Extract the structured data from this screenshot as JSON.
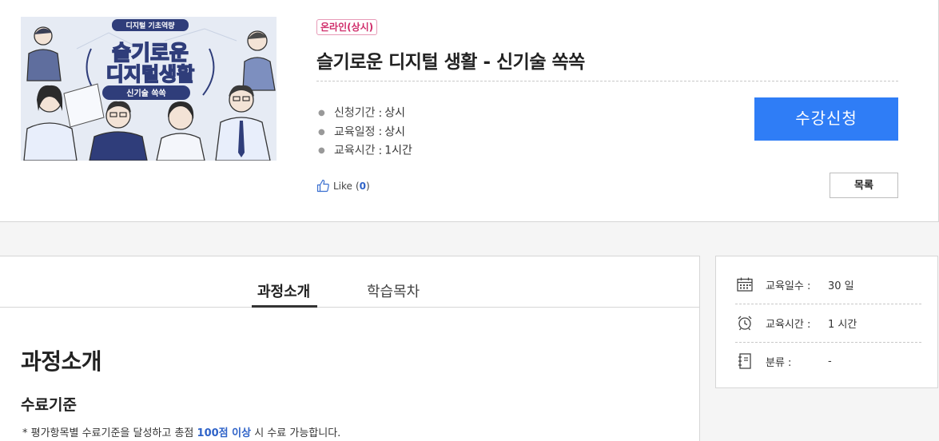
{
  "course": {
    "thumbnail": {
      "tag": "디지털 기초역량",
      "title_line1": "슬기로운",
      "title_line2": "디지털생활",
      "subtitle": "신기술 쏙쏙"
    },
    "badge": "온라인(상시)",
    "title": "슬기로운 디지털 생활 - 신기술 쏙쏙",
    "info": [
      {
        "label": "신청기간",
        "value": "상시"
      },
      {
        "label": "교육일정",
        "value": "상시"
      },
      {
        "label": "교육시간",
        "value": "1시간"
      }
    ],
    "info_separator": ":",
    "apply_label": "수강신청",
    "like_label": "Like",
    "like_count": "0",
    "list_label": "목록"
  },
  "tabs": [
    {
      "label": "과정소개",
      "active": true
    },
    {
      "label": "학습목차",
      "active": false
    }
  ],
  "content": {
    "section_title": "과정소개",
    "subsection_title": "수료기준",
    "note_prefix": "* 평가항목별 수료기준을 달성하고 총점 ",
    "note_highlight": "100점 이상",
    "note_suffix": " 시 수료 가능합니다."
  },
  "sidebar": {
    "rows": [
      {
        "icon": "calendar-icon",
        "label": "교육일수 :",
        "value": "30 일"
      },
      {
        "icon": "alarm-clock-icon",
        "label": "교육시간 :",
        "value": "1 시간"
      },
      {
        "icon": "notebook-icon",
        "label": "분류 :",
        "value": "-"
      }
    ]
  },
  "colors": {
    "accent": "#2f7df6",
    "badge": "#d02e6b",
    "highlight": "#2f63c8"
  }
}
